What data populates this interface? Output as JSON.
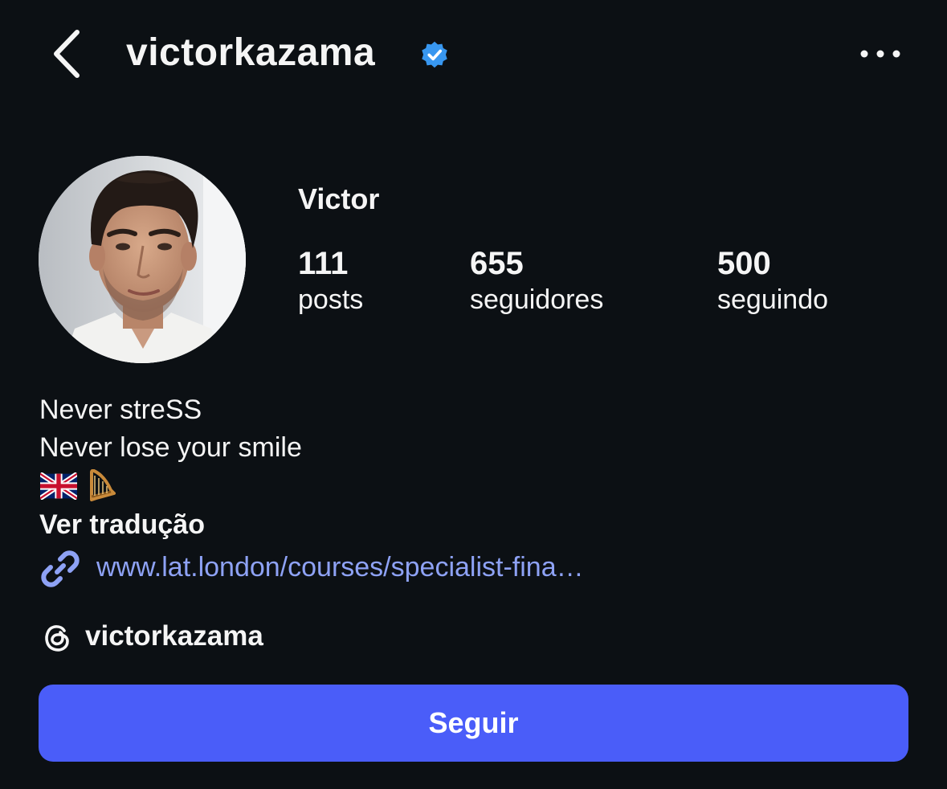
{
  "header": {
    "username": "victorkazama",
    "verified": true,
    "back_icon": "chevron-left-icon",
    "more_icon": "more-horizontal-icon"
  },
  "profile": {
    "display_name": "Victor",
    "stats": {
      "posts": {
        "value": "111",
        "label": "posts"
      },
      "followers": {
        "value": "655",
        "label": "seguidores"
      },
      "following": {
        "value": "500",
        "label": "seguindo"
      }
    }
  },
  "bio": {
    "line1": "Never streSS",
    "line2": "Never lose your smile",
    "emojis": [
      "uk-flag",
      "harp"
    ],
    "translate_label": "Ver tradução",
    "link": "www.lat.london/courses/specialist-fina…",
    "threads_handle": "victorkazama"
  },
  "actions": {
    "follow_label": "Seguir"
  },
  "colors": {
    "background": "#0c1014",
    "accent": "#4a5df9",
    "link": "#8ea2f5",
    "verified": "#3897f0"
  }
}
